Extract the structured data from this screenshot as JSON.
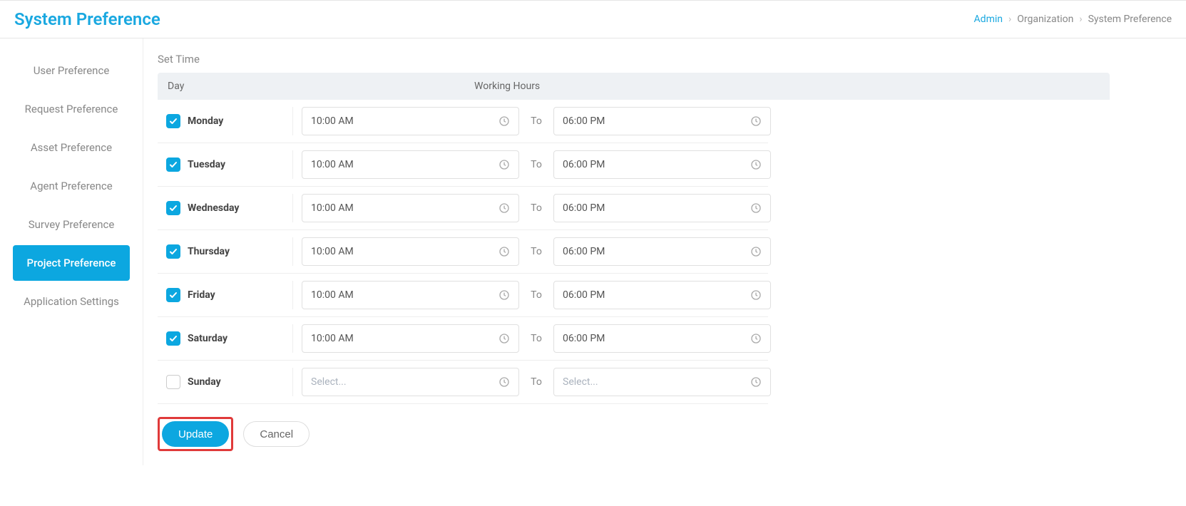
{
  "header": {
    "title": "System Preference",
    "breadcrumb": [
      "Admin",
      "Organization",
      "System Preference"
    ]
  },
  "sidebar": {
    "items": [
      {
        "label": "User Preference",
        "active": false
      },
      {
        "label": "Request Preference",
        "active": false
      },
      {
        "label": "Asset Preference",
        "active": false
      },
      {
        "label": "Agent Preference",
        "active": false
      },
      {
        "label": "Survey Preference",
        "active": false
      },
      {
        "label": "Project Preference",
        "active": true
      },
      {
        "label": "Application Settings",
        "active": false
      }
    ]
  },
  "section": {
    "title": "Set Time",
    "col_day": "Day",
    "col_hours": "Working Hours",
    "to_label": "To",
    "placeholder": "Select...",
    "rows": [
      {
        "day": "Monday",
        "checked": true,
        "from": "10:00 AM",
        "to": "06:00 PM"
      },
      {
        "day": "Tuesday",
        "checked": true,
        "from": "10:00 AM",
        "to": "06:00 PM"
      },
      {
        "day": "Wednesday",
        "checked": true,
        "from": "10:00 AM",
        "to": "06:00 PM"
      },
      {
        "day": "Thursday",
        "checked": true,
        "from": "10:00 AM",
        "to": "06:00 PM"
      },
      {
        "day": "Friday",
        "checked": true,
        "from": "10:00 AM",
        "to": "06:00 PM"
      },
      {
        "day": "Saturday",
        "checked": true,
        "from": "10:00 AM",
        "to": "06:00 PM"
      },
      {
        "day": "Sunday",
        "checked": false,
        "from": "",
        "to": ""
      }
    ]
  },
  "actions": {
    "update": "Update",
    "cancel": "Cancel"
  }
}
